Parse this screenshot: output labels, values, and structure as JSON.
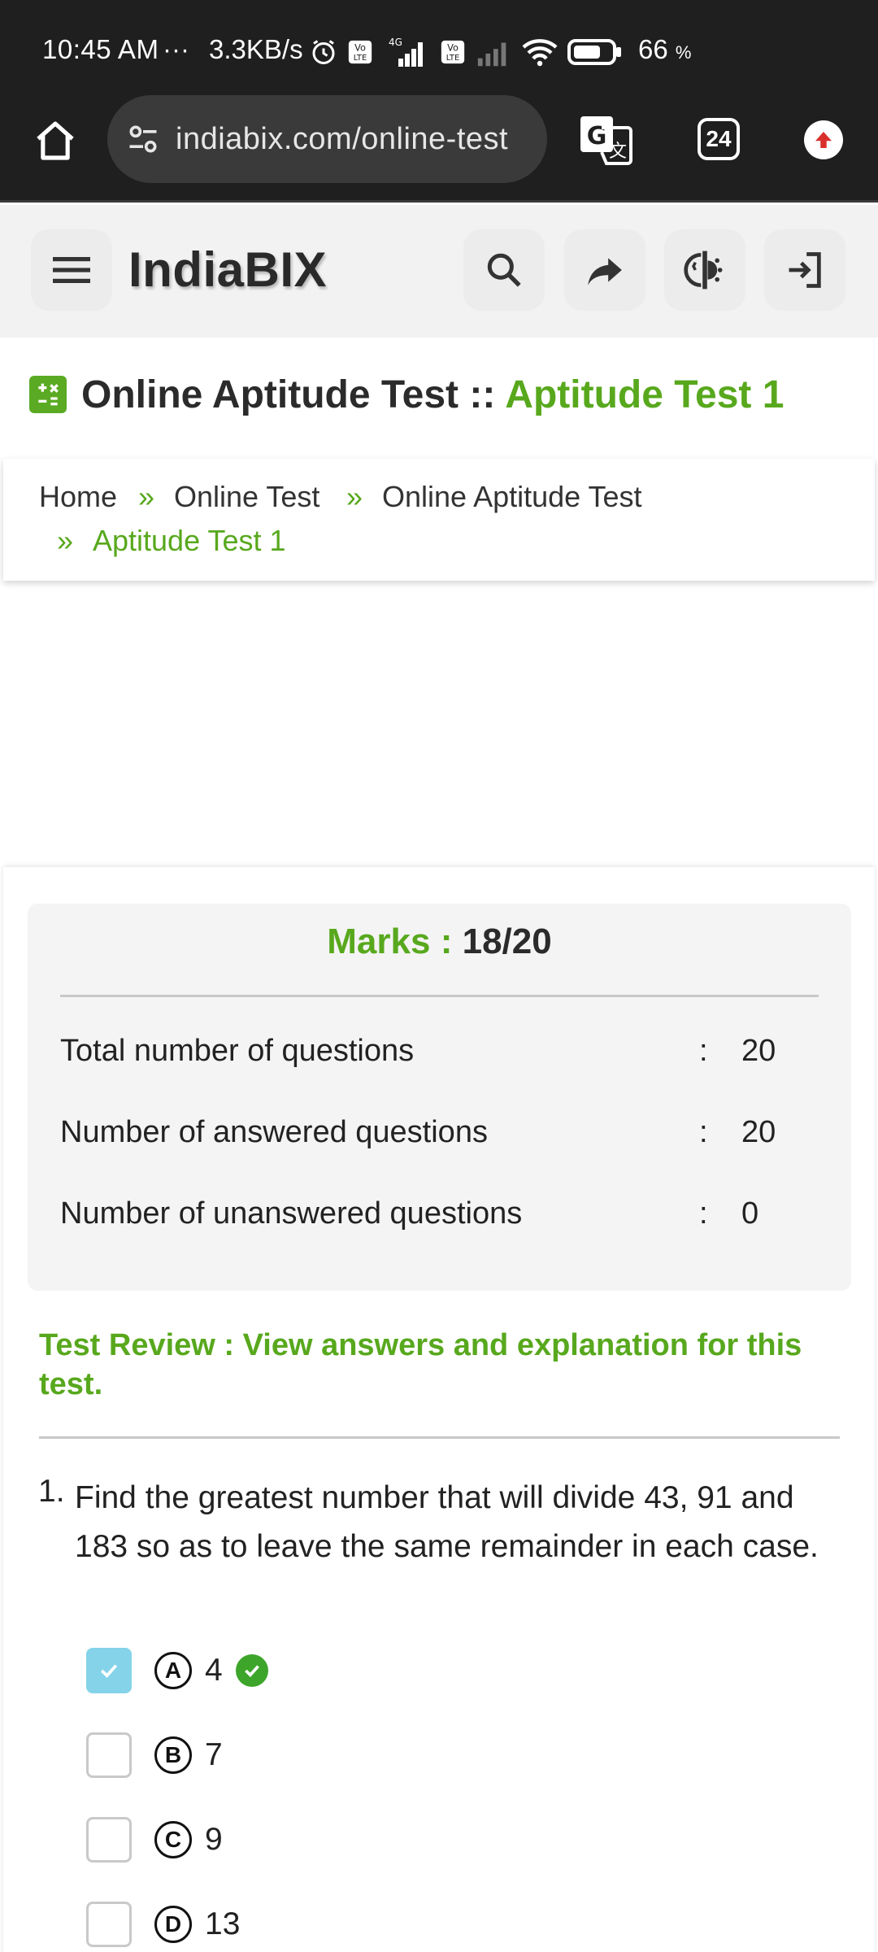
{
  "status_bar": {
    "time": "10:45 AM",
    "dots": "···",
    "net_speed": "3.3KB/s",
    "battery_pct": "66",
    "battery_unit": "%",
    "icons": [
      "alarm-icon",
      "volte-icon",
      "signal-4g-icon",
      "volte-icon",
      "signal-icon",
      "wifi-icon",
      "battery-icon"
    ]
  },
  "browser": {
    "url": "indiabix.com/online-test",
    "tab_count": "24"
  },
  "header": {
    "logo": "IndiaBIX"
  },
  "title": {
    "main": "Online Aptitude Test ::",
    "sub": "Aptitude Test 1"
  },
  "breadcrumb": {
    "home": "Home",
    "online_test": "Online Test",
    "aptitude": "Online Aptitude Test",
    "current": "Aptitude Test 1",
    "sep": "»"
  },
  "result": {
    "marks_label": "Marks :",
    "marks_value": "18/20",
    "rows": [
      {
        "label": "Total number of questions",
        "colon": ":",
        "value": "20"
      },
      {
        "label": "Number of answered questions",
        "colon": ":",
        "value": "20"
      },
      {
        "label": "Number of unanswered questions",
        "colon": ":",
        "value": "0"
      }
    ]
  },
  "review": {
    "heading": "Test Review : View answers and explanation for this test."
  },
  "question": {
    "number": "1.",
    "text": "Find the greatest number that will divide 43, 91 and 183 so as to leave the same remainder in each case.",
    "options": [
      {
        "letter": "A",
        "text": "4",
        "checked": true,
        "correct": true
      },
      {
        "letter": "B",
        "text": "7",
        "checked": false,
        "correct": false
      },
      {
        "letter": "C",
        "text": "9",
        "checked": false,
        "correct": false
      },
      {
        "letter": "D",
        "text": "13",
        "checked": false,
        "correct": false
      }
    ]
  },
  "colors": {
    "accent_green": "#58a81d",
    "checked_blue": "#84d3e9",
    "correct_green": "#3da52a",
    "dark_bar": "#1f1f1f"
  }
}
